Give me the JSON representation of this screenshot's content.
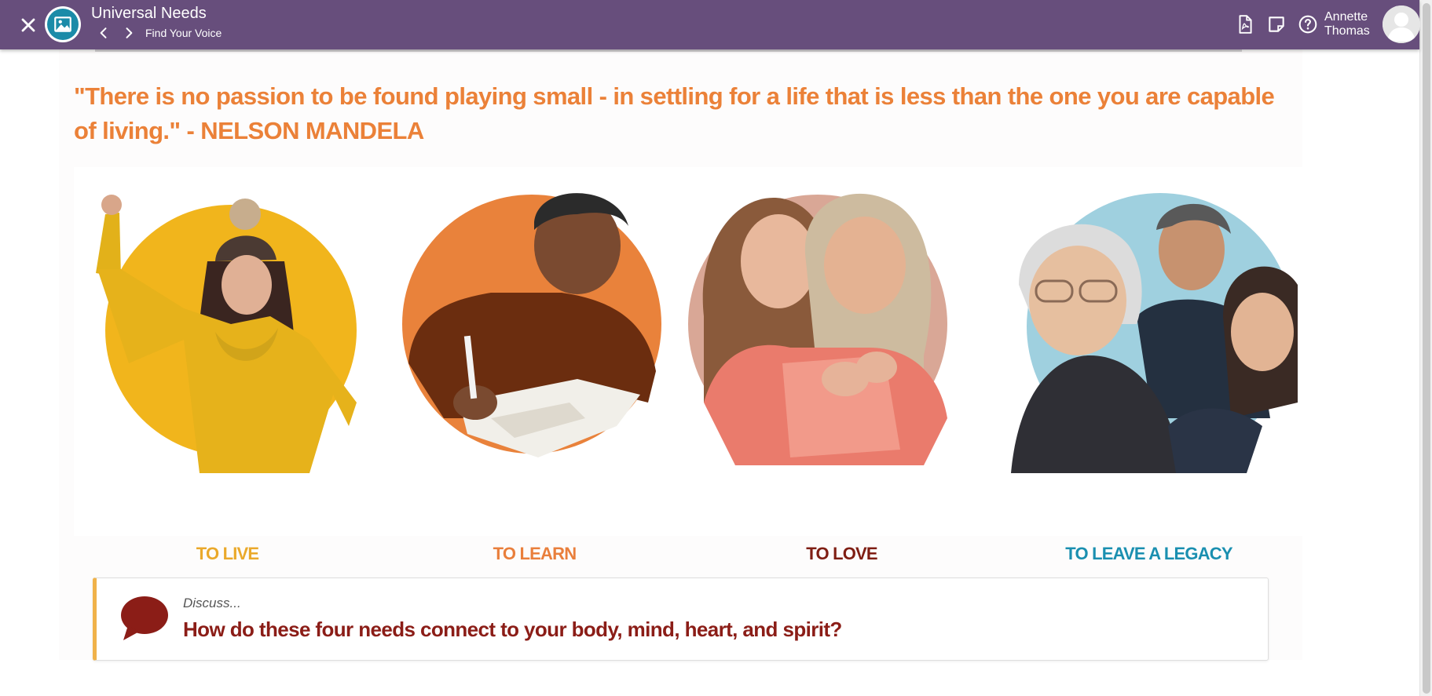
{
  "header": {
    "title": "Universal Needs",
    "subtitle": "Find Your Voice",
    "user_name_first": "Annette",
    "user_name_last": "Thomas",
    "icons": [
      "close-icon",
      "image-icon",
      "chevron-left-icon",
      "chevron-right-icon",
      "pdf-file-icon",
      "notes-icon",
      "help-icon",
      "user-avatar-icon"
    ],
    "bar_color": "#674e7c"
  },
  "main": {
    "quote": "\"There is no passion to be found playing small - in settling for a life that is less than the one you are capable of living.\" - NELSON MANDELA",
    "quote_color": "#eb8138",
    "needs": [
      {
        "label": "TO LIVE",
        "color": "#eaa92b",
        "circle_color": "#f1b51c"
      },
      {
        "label": "TO LEARN",
        "color": "#e97f3c",
        "circle_color": "#e9823b"
      },
      {
        "label": "TO LOVE",
        "color": "#7f1e13",
        "circle_color": "#d9a796"
      },
      {
        "label": "TO LEAVE A LEGACY",
        "color": "#1a8fb0",
        "circle_color": "#9fd0df"
      }
    ]
  },
  "discuss": {
    "kicker": "Discuss...",
    "question": "How do these four needs connect to your body, mind, heart, and spirit?",
    "accent_color": "#f0b24a",
    "icon": "speech-bubble-icon"
  }
}
